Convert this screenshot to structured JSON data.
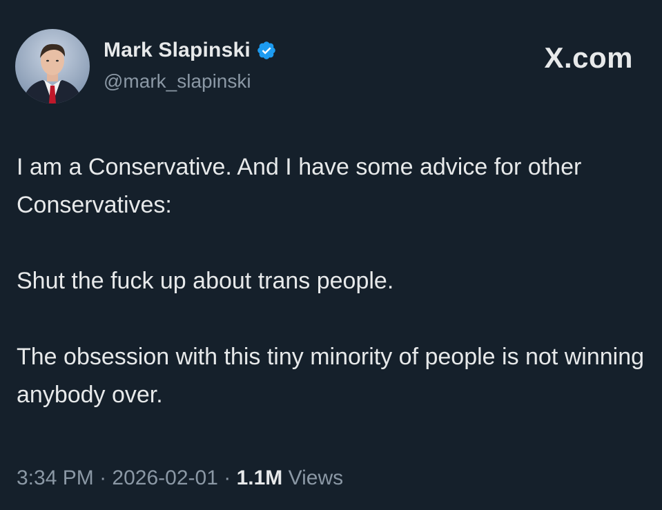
{
  "author": {
    "display_name": "Mark Slapinski",
    "handle": "@mark_slapinski",
    "verified_icon": "verified-badge-icon",
    "verified_color": "#1d9bf0"
  },
  "site_label": "X.com",
  "tweet": {
    "paragraphs": [
      "I am a Conservative. And I have some advice for other Conservatives:",
      "Shut the fuck up about trans people.",
      "The obsession with this tiny minority of people is not winning anybody over."
    ]
  },
  "meta": {
    "time": "3:34 PM",
    "separator": "·",
    "date": "2026-02-01",
    "views_count": "1.1M",
    "views_label": "Views"
  },
  "colors": {
    "background": "#15202b",
    "primary_text": "#e7e9ea",
    "secondary_text": "#8b98a5"
  }
}
